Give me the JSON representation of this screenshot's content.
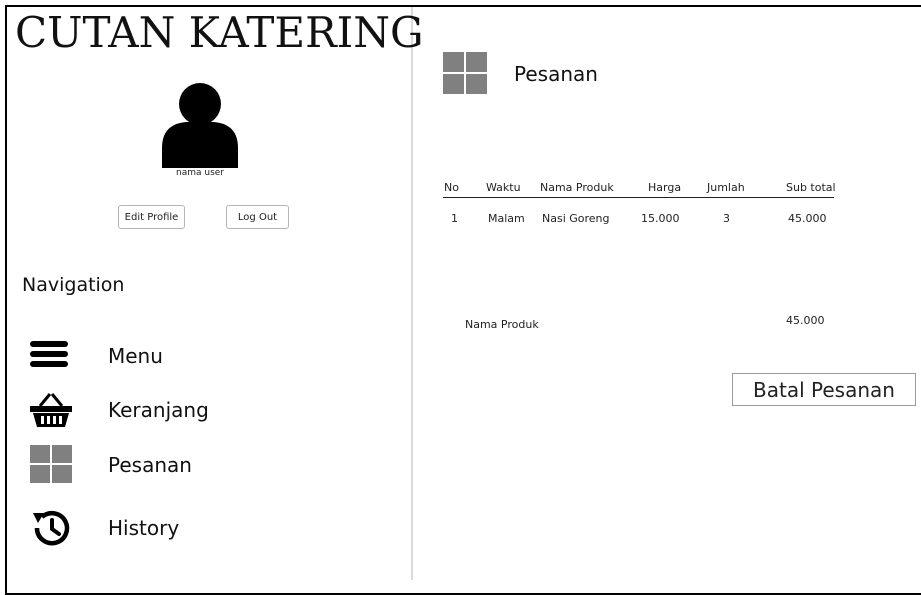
{
  "app": {
    "title": "CUTAN KATERING"
  },
  "user": {
    "name": "nama user",
    "edit_profile_label": "Edit Profile",
    "logout_label": "Log Out"
  },
  "navigation": {
    "heading": "Navigation",
    "items": [
      {
        "label": "Menu",
        "icon": "hamburger-menu-icon"
      },
      {
        "label": "Keranjang",
        "icon": "basket-icon"
      },
      {
        "label": "Pesanan",
        "icon": "grid-icon"
      },
      {
        "label": "History",
        "icon": "history-icon"
      }
    ]
  },
  "main": {
    "title": "Pesanan",
    "icon": "grid-icon",
    "table": {
      "columns": [
        "No",
        "Waktu",
        "Nama Produk",
        "Harga",
        "Jumlah",
        "Sub total"
      ],
      "rows": [
        [
          "1",
          "Malam",
          "Nasi Goreng",
          "15.000",
          "3",
          "45.000"
        ]
      ]
    },
    "summary": {
      "label": "Nama Produk",
      "value": "45.000"
    },
    "cancel_label": "Batal Pesanan"
  },
  "colors": {
    "icon_gray": "#808080",
    "icon_black": "#000000",
    "divider": "#d9d9d9"
  }
}
